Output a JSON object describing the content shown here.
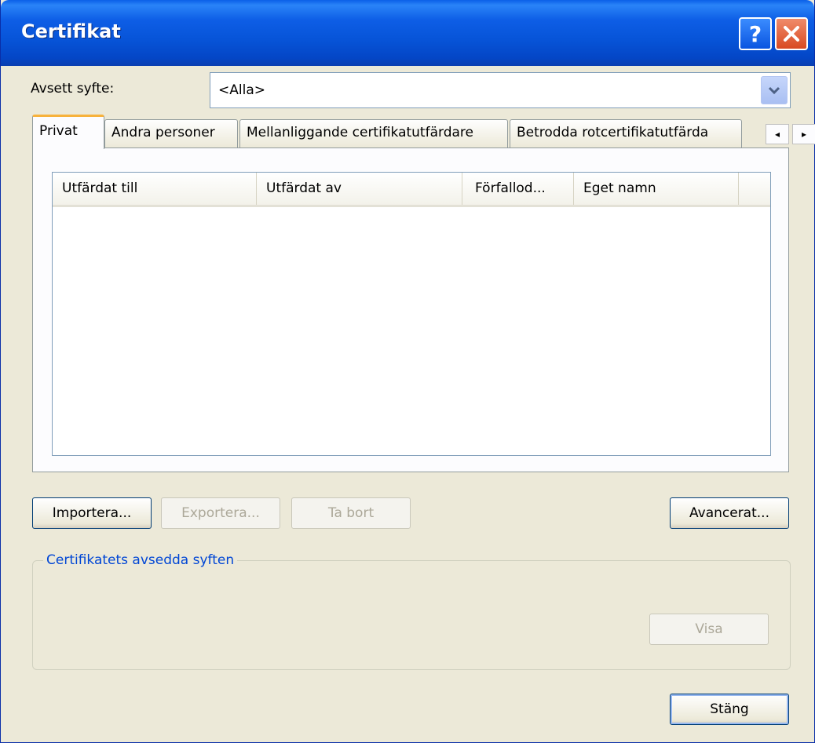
{
  "window": {
    "title": "Certifikat",
    "help_label": "?"
  },
  "purpose": {
    "label": "Avsett syfte:",
    "selected": "<Alla>"
  },
  "tabs": [
    {
      "label": "Privat",
      "active": true
    },
    {
      "label": "Andra personer",
      "active": false
    },
    {
      "label": "Mellanliggande certifikatutfärdare",
      "active": false
    },
    {
      "label": "Betrodda rotcertifikatutfärda",
      "active": false
    }
  ],
  "tab_scroll": {
    "left": "◂",
    "right": "▸"
  },
  "list": {
    "columns": [
      "Utfärdat till",
      "Utfärdat av",
      "Förfallod...",
      "Eget namn"
    ],
    "rows": []
  },
  "buttons": {
    "import": "Importera...",
    "export": "Exportera...",
    "remove": "Ta bort",
    "advanced": "Avancerat...",
    "view": "Visa",
    "close": "Stäng"
  },
  "group": {
    "legend": "Certifikatets avsedda syften"
  },
  "colors": {
    "titlebar": "#0754d8",
    "window_bg": "#ece9d8",
    "tab_highlight": "#f7b23c",
    "legend_text": "#0046d5",
    "close_button": "#d84a22"
  }
}
